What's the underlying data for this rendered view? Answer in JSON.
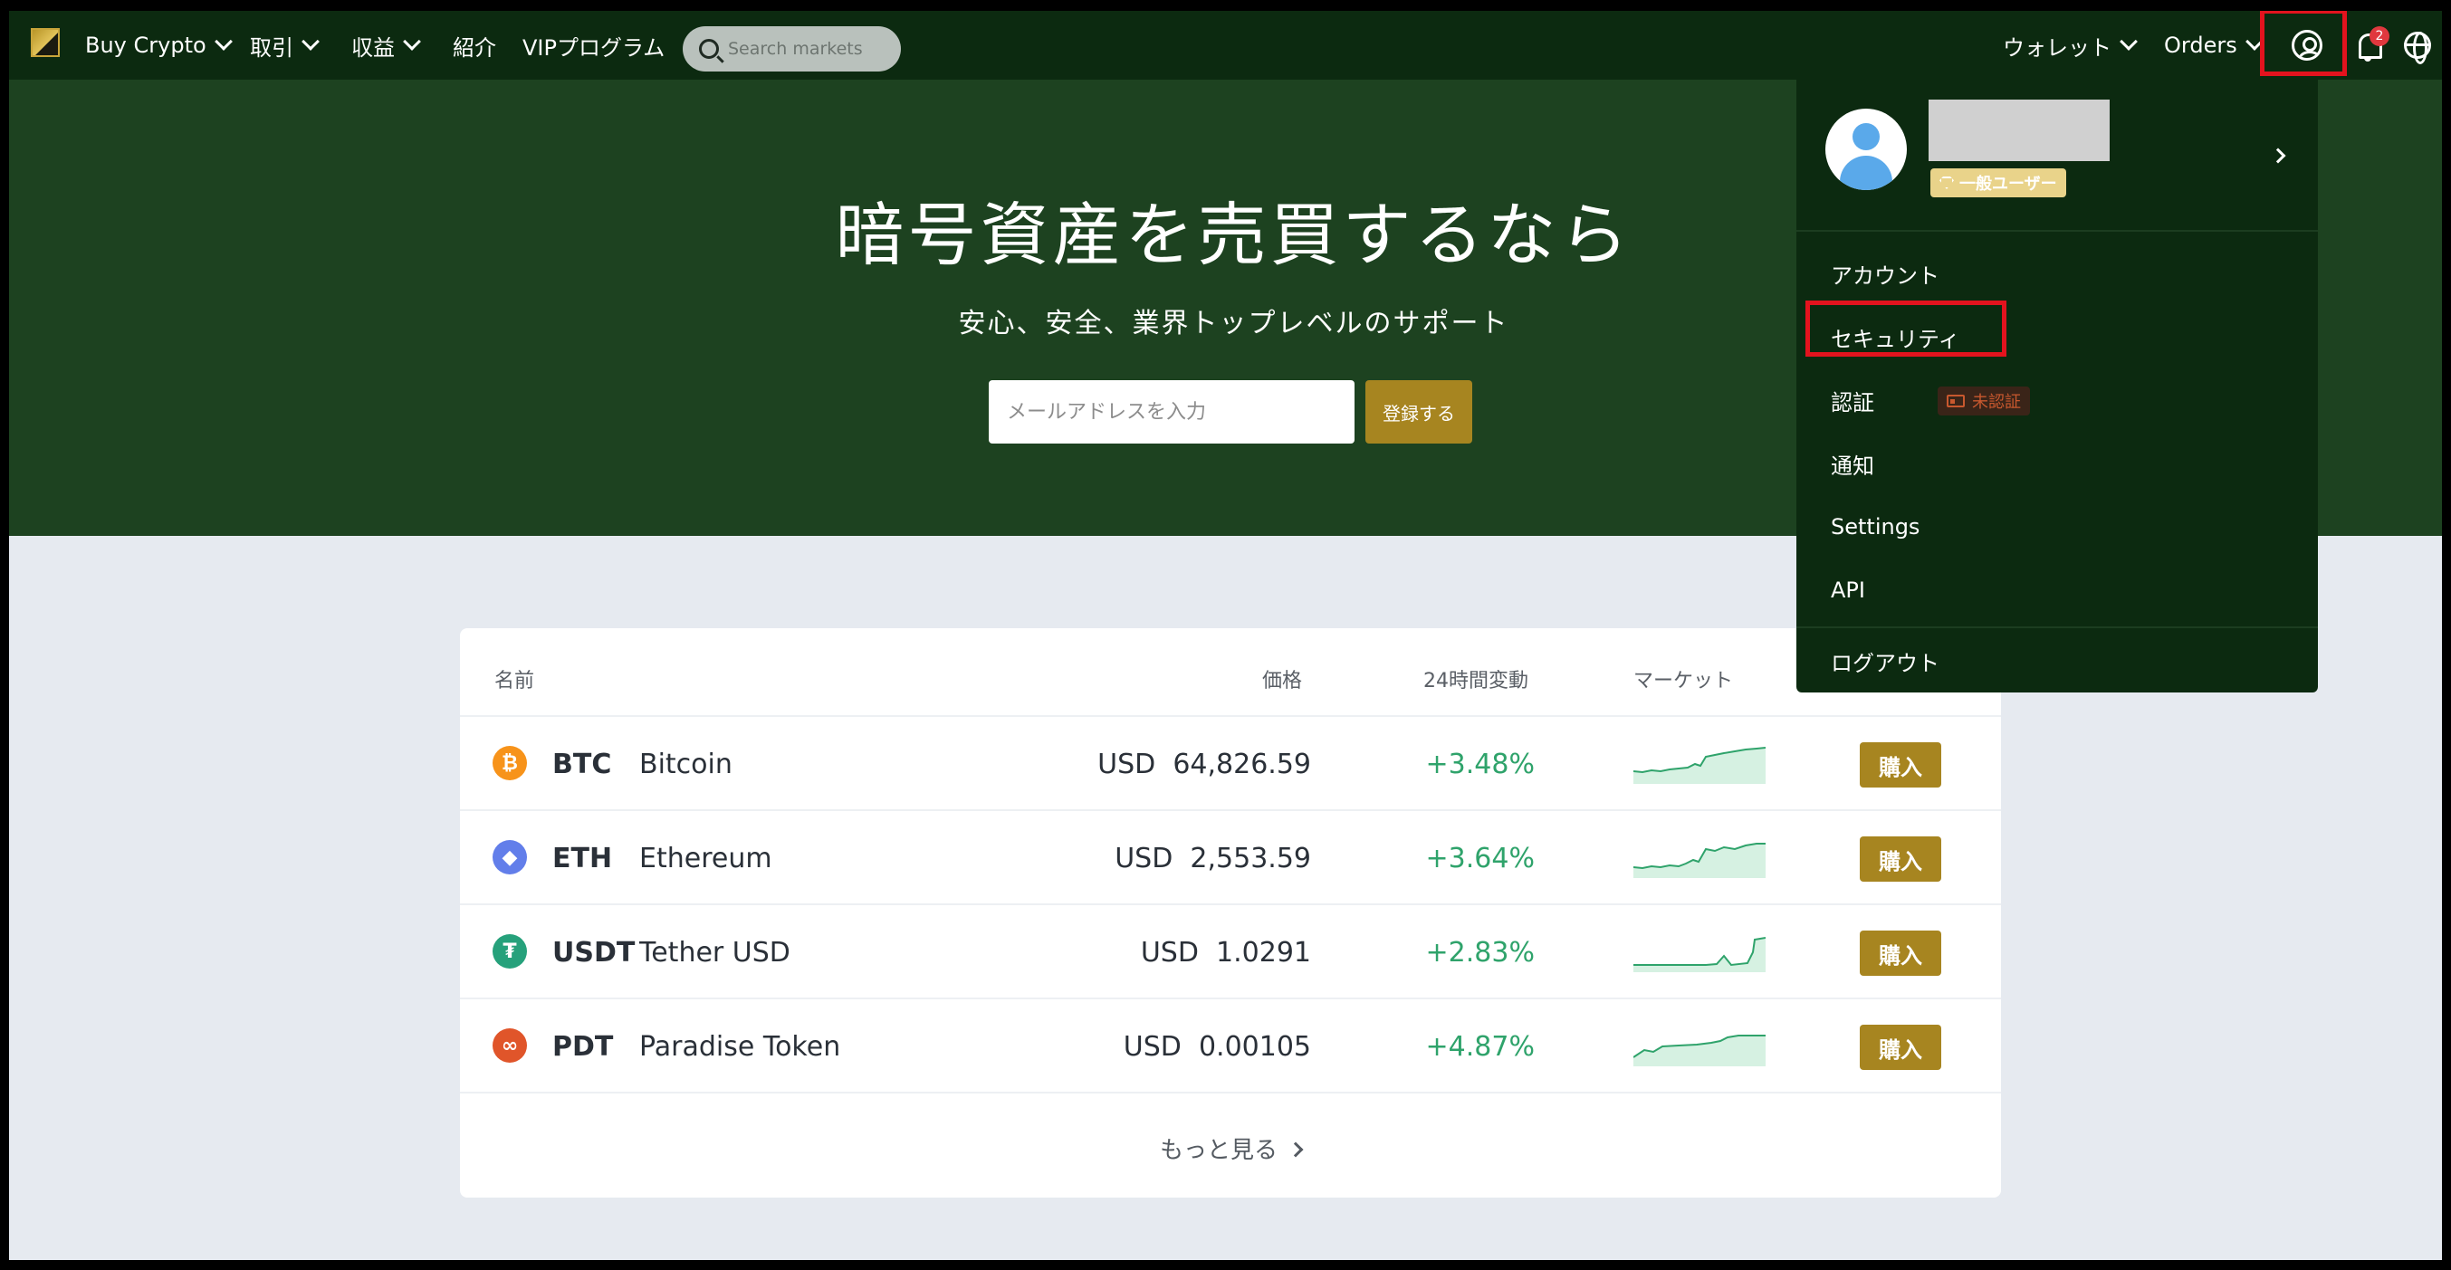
{
  "nav": {
    "items": [
      {
        "label": "Buy Crypto",
        "has_dropdown": true
      },
      {
        "label": "取引",
        "has_dropdown": true
      },
      {
        "label": "収益",
        "has_dropdown": true
      },
      {
        "label": "紹介",
        "has_dropdown": false
      },
      {
        "label": "VIPプログラム",
        "has_dropdown": false
      }
    ],
    "search_placeholder": "Search markets",
    "wallet_label": "ウォレット",
    "orders_label": "Orders",
    "notification_count": "2"
  },
  "hero": {
    "title": "暗号資産を売買するなら",
    "subtitle": "安心、安全、業界トップレベルのサポート",
    "email_placeholder": "メールアドレスを入力",
    "signup_label": "登録する"
  },
  "markets": {
    "headers": {
      "name": "名前",
      "price": "価格",
      "change": "24時間変動",
      "market": "マーケット"
    },
    "rows": [
      {
        "symbol": "BTC",
        "name": "Bitcoin",
        "price": "USD  64,826.59",
        "change": "+3.48%",
        "buy_label": "購入",
        "icon_color": "#f7931a",
        "icon_glyph": "₿",
        "icon": "bitcoin-icon"
      },
      {
        "symbol": "ETH",
        "name": "Ethereum",
        "price": "USD  2,553.59",
        "change": "+3.64%",
        "buy_label": "購入",
        "icon_color": "#627eea",
        "icon_glyph": "◆",
        "icon": "ethereum-icon"
      },
      {
        "symbol": "USDT",
        "name": "Tether USD",
        "price": "USD  1.0291",
        "change": "+2.83%",
        "buy_label": "購入",
        "icon_color": "#26a17b",
        "icon_glyph": "₮",
        "icon": "tether-icon"
      },
      {
        "symbol": "PDT",
        "name": "Paradise Token",
        "price": "USD  0.00105",
        "change": "+4.87%",
        "buy_label": "購入",
        "icon_color": "#e0552a",
        "icon_glyph": "∞",
        "icon": "paradise-token-icon"
      }
    ],
    "more_label": "もっと見る"
  },
  "user_menu": {
    "tier": "一般ユーザー",
    "items": [
      {
        "label": "アカウント"
      },
      {
        "label": "セキュリティ"
      },
      {
        "label": "認証",
        "badge": "未認証"
      },
      {
        "label": "通知"
      },
      {
        "label": "Settings"
      },
      {
        "label": "API"
      }
    ],
    "logout_label": "ログアウト"
  },
  "colors": {
    "nav_bg": "#0c2a10",
    "hero_bg": "#1d4220",
    "accent_gold": "#a78520",
    "positive_green": "#2fa36b",
    "highlight_red": "#e3131e"
  }
}
